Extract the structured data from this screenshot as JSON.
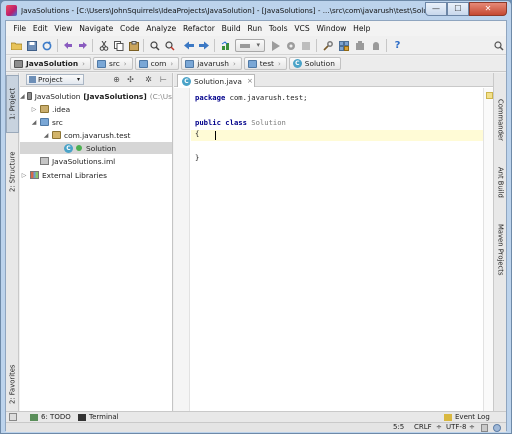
{
  "window": {
    "title": "JavaSolutions - [C:\\Users\\JohnSquirrels\\IdeaProjects\\JavaSolution] - [JavaSolutions] - ...\\src\\com\\javarush\\test\\Solution.java",
    "min_glyph": "—",
    "max_glyph": "☐",
    "close_glyph": "✕"
  },
  "menu": [
    "File",
    "Edit",
    "View",
    "Navigate",
    "Code",
    "Analyze",
    "Refactor",
    "Build",
    "Run",
    "Tools",
    "VCS",
    "Window",
    "Help"
  ],
  "navbar": {
    "crumbs": [
      "JavaSolution",
      "src",
      "com",
      "javarush",
      "test",
      "Solution"
    ]
  },
  "left_tabs": {
    "project": "1: Project",
    "structure": "2: Structure",
    "favorites": "2: Favorites"
  },
  "right_tabs": {
    "commander": "Commander",
    "ant_build": "Ant Build",
    "maven": "Maven Projects"
  },
  "project_panel": {
    "view_selector": "Project",
    "tree": {
      "root_name": "JavaSolution",
      "root_module": "[JavaSolutions]",
      "root_path": "(C:\\Us",
      "idea": ".idea",
      "src": "src",
      "package": "com.javarush.test",
      "solution": "Solution",
      "iml": "JavaSolutions.iml",
      "libs": "External Libraries"
    }
  },
  "editor": {
    "tab_label": "Solution.java",
    "tab_close": "×",
    "code": {
      "l1_kw": "package",
      "l1_rest": " com.javarush.test;",
      "l3_kw1": "public",
      "l3_kw2": " class",
      "l3_name": " Solution",
      "l4": "{",
      "l6": "}"
    }
  },
  "bottom_tools": {
    "todo": "6: TODO",
    "terminal": "Terminal",
    "event_log": "Event Log"
  },
  "status": {
    "position": "5:5",
    "line_sep": "CRLF",
    "encoding": "UTF-8"
  },
  "icons": [
    "folder-icon",
    "class-icon",
    "package-icon",
    "module-icon",
    "library-icon",
    "settings-icon",
    "help-icon",
    "search-icon"
  ]
}
